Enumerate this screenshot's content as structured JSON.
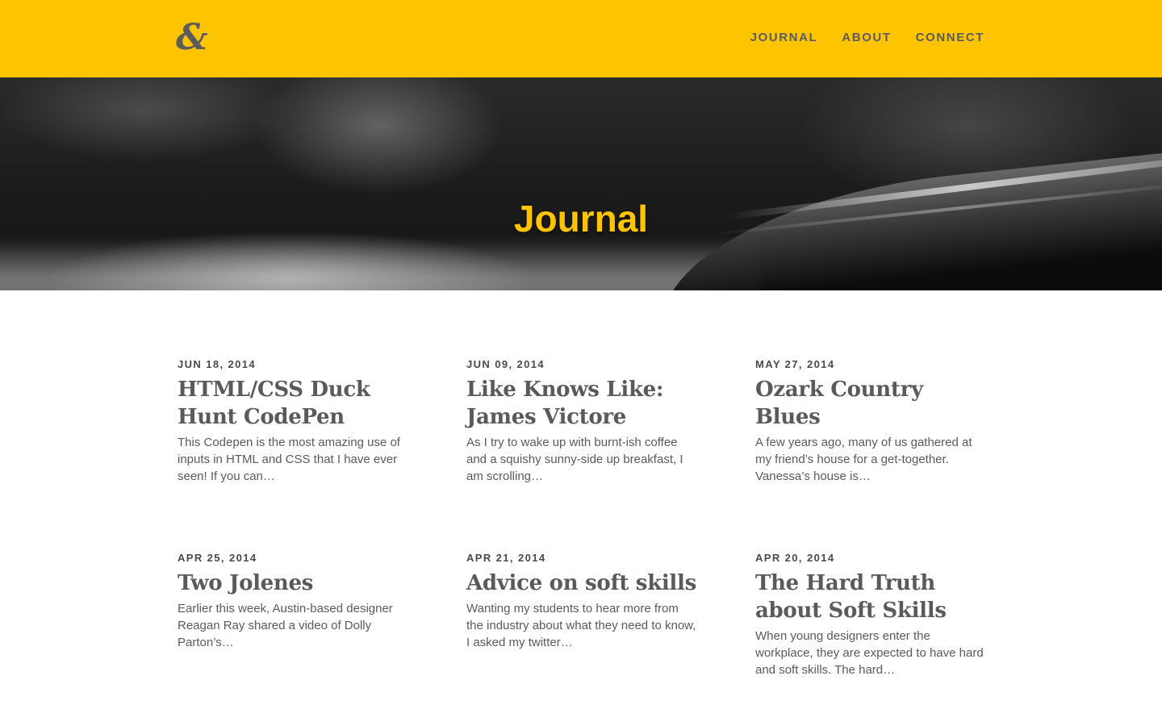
{
  "header": {
    "logo_text": "&",
    "background_color": "#ffc400",
    "nav": [
      {
        "label": "JOURNAL"
      },
      {
        "label": "ABOUT"
      },
      {
        "label": "CONNECT"
      }
    ]
  },
  "hero": {
    "title": "Journal",
    "title_color": "#ffc400"
  },
  "posts": [
    {
      "date": "JUN 18, 2014",
      "title": "HTML/CSS Duck Hunt CodePen",
      "excerpt": "This Codepen is the most amazing use of inputs in HTML and CSS that I have ever seen! If you can…"
    },
    {
      "date": "JUN 09, 2014",
      "title": "Like Knows Like: James Victore",
      "excerpt": "As I try to wake up with burnt-ish coffee and a squishy sunny-side up breakfast, I am scrolling…"
    },
    {
      "date": "MAY 27, 2014",
      "title": "Ozark Country Blues",
      "excerpt": "A few years ago, many of us gathered at my friend’s house for a get-together. Vanessa’s house is…"
    },
    {
      "date": "APR 25, 2014",
      "title": "Two Jolenes",
      "excerpt": "Earlier this week, Austin-based designer Reagan Ray shared a video of Dolly Parton’s…"
    },
    {
      "date": "APR 21, 2014",
      "title": "Advice on soft skills",
      "excerpt": "Wanting my students to hear more from the industry about what they need to know, I asked my twitter…"
    },
    {
      "date": "APR 20, 2014",
      "title": "The Hard Truth about Soft Skills",
      "excerpt": "When young designers enter the workplace, they are expected to have hard and soft skills. The hard…"
    }
  ]
}
